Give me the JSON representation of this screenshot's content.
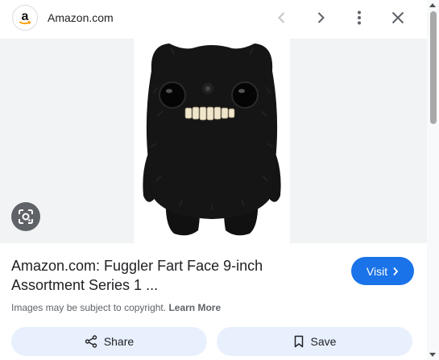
{
  "header": {
    "logo_letter": "a",
    "site_name": "Amazon.com",
    "icons": [
      "amazon-logo-icon",
      "chevron-left-icon",
      "chevron-right-icon",
      "more-vert-icon",
      "close-icon"
    ]
  },
  "image": {
    "lens_icon": "google-lens-icon"
  },
  "result": {
    "title": "Amazon.com: Fuggler Fart Face 9-inch Assortment Series 1 ...",
    "visit_label": "Visit",
    "copyright_text": "Images may be subject to copyright.",
    "learn_more": "Learn More"
  },
  "actions": {
    "share_label": "Share",
    "save_label": "Save"
  },
  "colors": {
    "accent": "#1a73e8",
    "button_bg": "#e8f0fe",
    "image_bg": "#f1f3f4",
    "lens_bg": "#5f6368"
  }
}
